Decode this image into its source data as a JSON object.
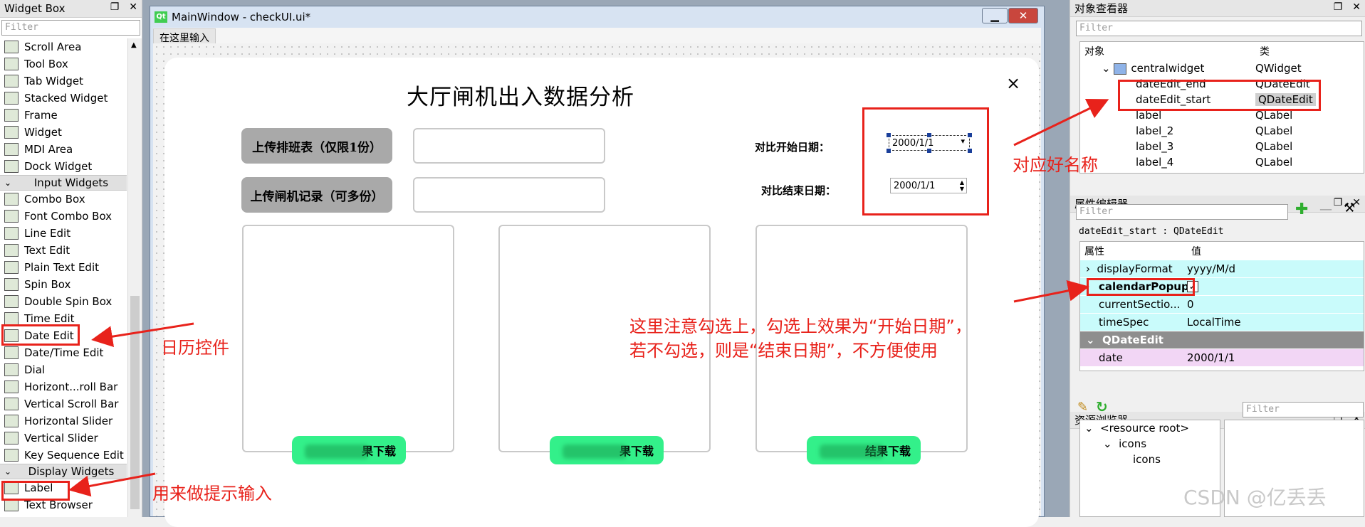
{
  "widget_box": {
    "title": "Widget Box",
    "filter_placeholder": "Filter",
    "items_top": [
      {
        "label": "Scroll Area",
        "icon": "scroll-area-icon"
      },
      {
        "label": "Tool Box",
        "icon": "tool-box-icon"
      },
      {
        "label": "Tab Widget",
        "icon": "tab-widget-icon"
      },
      {
        "label": "Stacked Widget",
        "icon": "stacked-widget-icon"
      },
      {
        "label": "Frame",
        "icon": "frame-icon"
      },
      {
        "label": "Widget",
        "icon": "widget-icon"
      },
      {
        "label": "MDI Area",
        "icon": "mdi-area-icon"
      },
      {
        "label": "Dock Widget",
        "icon": "dock-widget-icon"
      }
    ],
    "category_input": "Input Widgets",
    "items_input": [
      {
        "label": "Combo Box",
        "icon": "combo-box-icon"
      },
      {
        "label": "Font Combo Box",
        "icon": "font-combo-box-icon"
      },
      {
        "label": "Line Edit",
        "icon": "line-edit-icon"
      },
      {
        "label": "Text Edit",
        "icon": "text-edit-icon"
      },
      {
        "label": "Plain Text Edit",
        "icon": "plain-text-edit-icon"
      },
      {
        "label": "Spin Box",
        "icon": "spin-box-icon"
      },
      {
        "label": "Double Spin Box",
        "icon": "double-spin-box-icon"
      },
      {
        "label": "Time Edit",
        "icon": "time-edit-icon"
      },
      {
        "label": "Date Edit",
        "icon": "date-edit-icon"
      },
      {
        "label": "Date/Time Edit",
        "icon": "datetime-edit-icon"
      },
      {
        "label": "Dial",
        "icon": "dial-icon"
      },
      {
        "label": "Horizont...roll Bar",
        "icon": "horizontal-scroll-bar-icon"
      },
      {
        "label": "Vertical Scroll Bar",
        "icon": "vertical-scroll-bar-icon"
      },
      {
        "label": "Horizontal Slider",
        "icon": "horizontal-slider-icon"
      },
      {
        "label": "Vertical Slider",
        "icon": "vertical-slider-icon"
      },
      {
        "label": "Key Sequence Edit",
        "icon": "key-sequence-edit-icon"
      }
    ],
    "category_display": "Display Widgets",
    "items_display": [
      {
        "label": "Label",
        "icon": "label-icon"
      },
      {
        "label": "Text Browser",
        "icon": "text-browser-icon"
      }
    ]
  },
  "main_window": {
    "title": "MainWindow - checkUI.ui*",
    "menu_placeholder": "在这里输入",
    "form": {
      "title": "大厅闸机出入数据分析",
      "close_glyph": "×",
      "upload_schedule_label": "上传排班表（仅限1份）",
      "upload_gate_label": "上传闸机记录（可多份）",
      "compare_start_label": "对比开始日期：",
      "compare_end_label": "对比结束日期：",
      "date_start_value": "2000/1/1",
      "date_end_value": "2000/1/1",
      "download_label": "结果下载",
      "download_label_2": "果下载"
    }
  },
  "object_inspector": {
    "title": "对象查看器",
    "filter_placeholder": "Filter",
    "col_object": "对象",
    "col_class": "类",
    "rows": [
      {
        "object": "centralwidget",
        "class": "QWidget"
      },
      {
        "object": "dateEdit_end",
        "class": "QDateEdit"
      },
      {
        "object": "dateEdit_start",
        "class": "QDateEdit"
      },
      {
        "object": "label",
        "class": "QLabel"
      },
      {
        "object": "label_2",
        "class": "QLabel"
      },
      {
        "object": "label_3",
        "class": "QLabel"
      },
      {
        "object": "label_4",
        "class": "QLabel"
      }
    ]
  },
  "property_editor": {
    "title": "属性编辑器",
    "filter_placeholder": "Filter",
    "context": "dateEdit_start : QDateEdit",
    "col_property": "属性",
    "col_value": "值",
    "rows": [
      {
        "name": "displayFormat",
        "value": "yyyy/M/d"
      },
      {
        "name": "calendarPopup",
        "value": "✓"
      },
      {
        "name": "currentSectio...",
        "value": "0"
      },
      {
        "name": "timeSpec",
        "value": "LocalTime"
      }
    ],
    "section": "QDateEdit",
    "date_name": "date",
    "date_value": "2000/1/1"
  },
  "resource_browser": {
    "title": "资源浏览器",
    "filter_placeholder": "Filter",
    "tree": [
      "<resource root>",
      "icons",
      "icons"
    ]
  },
  "annotations": {
    "names_match": "对应好名称",
    "calendar_control": "日历控件",
    "label_hint": "用来做提示输入",
    "check_note_1": "这里注意勾选上，勾选上效果为“开始日期”，",
    "check_note_2": "若不勾选，则是“结束日期”，不方便使用"
  },
  "watermark": "CSDN @亿丢丢",
  "colors": {
    "accent_red": "#e8221b",
    "download_green": "#33f08a",
    "gray_button": "#a9a9a9",
    "property_cyan": "#c9fbfb",
    "property_pink": "#f2d6f5"
  }
}
